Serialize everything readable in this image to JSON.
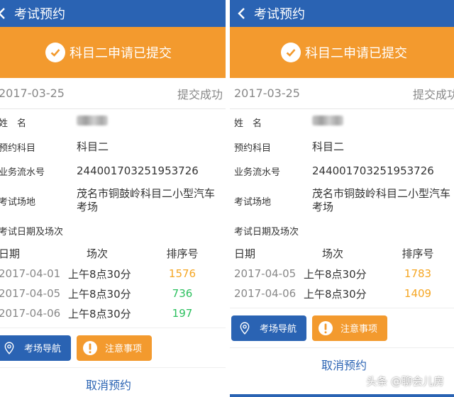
{
  "colors": {
    "primary": "#2a63b3",
    "accent": "#f39a2e",
    "rank_orange": "#f5a623",
    "rank_green": "#2cc05e"
  },
  "panels": [
    {
      "header_title": "考试预约",
      "banner": "科目二申请已提交",
      "date": "2017-03-25",
      "status": "提交成功",
      "info": {
        "name_label": "姓　名",
        "subject_label": "预约科目",
        "subject": "科目二",
        "serial_label": "业务流水号",
        "serial": "244001703251953726",
        "venue_label": "考试场地",
        "venue": "茂名市铜鼓岭科目二小型汽车考场",
        "schedule_label": "考试日期及场次"
      },
      "table": {
        "headers": [
          "日期",
          "场次",
          "排序号"
        ],
        "rows": [
          {
            "date": "2017-04-01",
            "session": "上午8点30分",
            "rank": "1576",
            "rank_color": "orange"
          },
          {
            "date": "2017-04-05",
            "session": "上午8点30分",
            "rank": "736",
            "rank_color": "green"
          },
          {
            "date": "2017-04-06",
            "session": "上午8点30分",
            "rank": "197",
            "rank_color": "green"
          }
        ]
      },
      "buttons": {
        "nav": "考场导航",
        "note": "注意事项",
        "cancel": "取消预约"
      }
    },
    {
      "header_title": "考试预约",
      "banner": "科目二申请已提交",
      "date": "2017-03-25",
      "status": "提交成功",
      "info": {
        "name_label": "姓　名",
        "subject_label": "预约科目",
        "subject": "科目二",
        "serial_label": "业务流水号",
        "serial": "244001703251953726",
        "venue_label": "考试场地",
        "venue": "茂名市铜鼓岭科目二小型汽车考场",
        "schedule_label": "考试日期及场次"
      },
      "table": {
        "headers": [
          "日期",
          "场次",
          "排序号"
        ],
        "rows": [
          {
            "date": "2017-04-05",
            "session": "上午8点30分",
            "rank": "1783",
            "rank_color": "orange"
          },
          {
            "date": "2017-04-06",
            "session": "上午8点30分",
            "rank": "1409",
            "rank_color": "orange"
          }
        ]
      },
      "buttons": {
        "nav": "考场导航",
        "note": "注意事项",
        "cancel": "取消预约"
      }
    }
  ],
  "watermark": "头条 @聊会儿房",
  "icons": {
    "back": "chevron-left-icon",
    "check": "check-circle-icon",
    "location": "map-pin-icon",
    "notice": "exclamation-icon"
  }
}
